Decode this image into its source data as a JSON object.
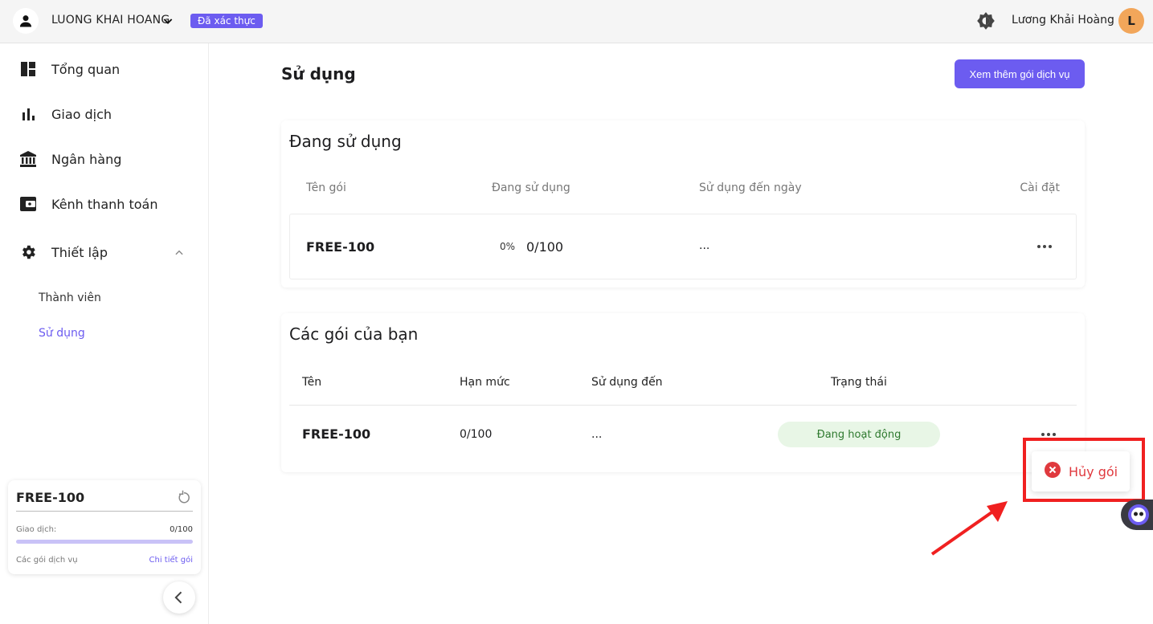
{
  "header": {
    "account_name": "LUONG KHAI HOANG",
    "verified_badge": "Đã xác thực",
    "username": "Lương Khải Hoàng",
    "avatar_letter": "L"
  },
  "sidebar": {
    "nav": [
      {
        "label": "Tổng quan",
        "icon": "dashboard-icon"
      },
      {
        "label": "Giao dịch",
        "icon": "bar-chart-icon"
      },
      {
        "label": "Ngân hàng",
        "icon": "bank-icon"
      },
      {
        "label": "Kênh thanh toán",
        "icon": "wallet-icon"
      },
      {
        "label": "Thiết lập",
        "icon": "gear-icon"
      }
    ],
    "sub_items": [
      {
        "label": "Thành viên"
      },
      {
        "label": "Sử dụng"
      }
    ],
    "plan_card": {
      "title": "FREE-100",
      "tx_label": "Giao dịch:",
      "tx_value": "0/100",
      "tx_progress_fraction": 0.0,
      "packages_label": "Các gói dịch vụ",
      "detail_link": "Chi tiết gói"
    }
  },
  "main": {
    "title": "Sử dụng",
    "more_plans_button": "Xem thêm gói dịch vụ",
    "in_use": {
      "title": "Đang sử dụng",
      "columns": [
        "Tên gói",
        "Đang sử dụng",
        "Sử dụng đến ngày",
        "Cài đặt"
      ],
      "row": {
        "name": "FREE-100",
        "percent": "0%",
        "usage": "0/100",
        "until": "..."
      }
    },
    "your_plans": {
      "title": "Các gói của bạn",
      "columns": [
        "Tên",
        "Hạn mức",
        "Sử dụng đến",
        "Trạng thái"
      ],
      "row": {
        "name": "FREE-100",
        "limit": "0/100",
        "until": "...",
        "status": "Đang hoạt động"
      }
    },
    "dropdown": {
      "cancel_label": "Hủy gói"
    }
  },
  "colors": {
    "accent": "#6c5cf0",
    "danger": "#e0393e",
    "status_bg": "#e8f6e6",
    "status_text": "#2f7a2f",
    "annotation": "#f02020"
  }
}
